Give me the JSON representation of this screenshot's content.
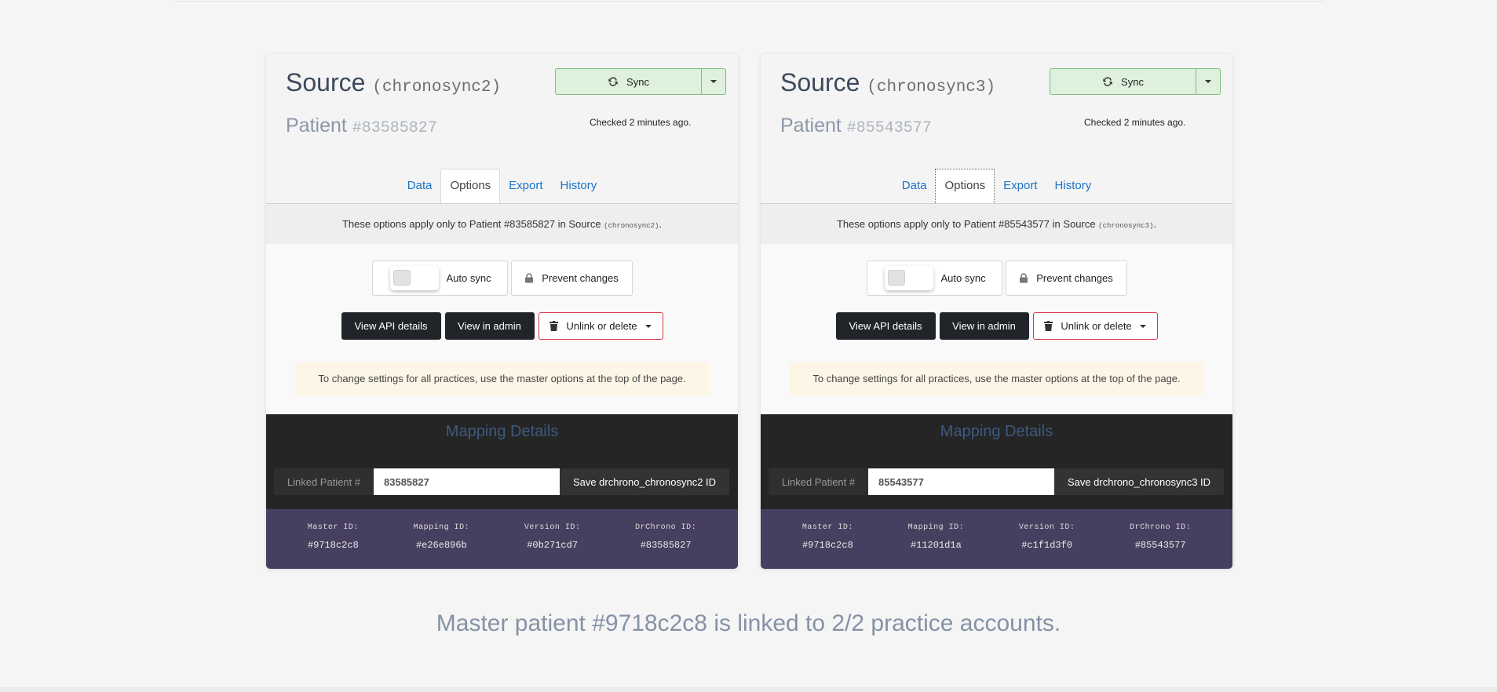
{
  "cards": [
    {
      "source_label": "Source",
      "source_code": "(chronosync2)",
      "patient_label": "Patient",
      "patient_num": "#83585827",
      "sync_label": "Sync",
      "checked": "Checked 2 minutes ago.",
      "tabs": [
        "Data",
        "Options",
        "Export",
        "History"
      ],
      "note_prefix": "These options apply only to Patient #83585827 in Source ",
      "note_code": "(chronosync2)",
      "note_suffix": ".",
      "auto_sync": "Auto sync",
      "prevent": "Prevent changes",
      "view_api": "View API details",
      "view_admin": "View in admin",
      "unlink": "Unlink or delete",
      "warn": "To change settings for all practices, use the master options at the top of the page.",
      "mapping_title": "Mapping Details",
      "linked_label": "Linked Patient #",
      "linked_value": "83585827",
      "save_label": "Save drchrono_chronosync2 ID",
      "ids": [
        {
          "label": "Master ID:",
          "value": "#9718c2c8"
        },
        {
          "label": "Mapping ID:",
          "value": "#e26e896b"
        },
        {
          "label": "Version ID:",
          "value": "#0b271cd7"
        },
        {
          "label": "DrChrono ID:",
          "value": "#83585827"
        }
      ]
    },
    {
      "source_label": "Source",
      "source_code": "(chronosync3)",
      "patient_label": "Patient",
      "patient_num": "#85543577",
      "sync_label": "Sync",
      "checked": "Checked 2 minutes ago.",
      "tabs": [
        "Data",
        "Options",
        "Export",
        "History"
      ],
      "note_prefix": "These options apply only to Patient #85543577 in Source ",
      "note_code": "(chronosync3)",
      "note_suffix": ".",
      "auto_sync": "Auto sync",
      "prevent": "Prevent changes",
      "view_api": "View API details",
      "view_admin": "View in admin",
      "unlink": "Unlink or delete",
      "warn": "To change settings for all practices, use the master options at the top of the page.",
      "mapping_title": "Mapping Details",
      "linked_label": "Linked Patient #",
      "linked_value": "85543577",
      "save_label": "Save drchrono_chronosync3 ID",
      "ids": [
        {
          "label": "Master ID:",
          "value": "#9718c2c8"
        },
        {
          "label": "Mapping ID:",
          "value": "#11201d1a"
        },
        {
          "label": "Version ID:",
          "value": "#c1f1d3f0"
        },
        {
          "label": "DrChrono ID:",
          "value": "#85543577"
        }
      ]
    }
  ],
  "footer": "Master patient #9718c2c8 is linked to 2/2 practice accounts.",
  "colors": {
    "sync_bg": "#ddf1dd",
    "danger": "#dc3545",
    "mapping_bg": "#252525",
    "ids_bg": "#473f5f",
    "tab_link": "#1a73c6"
  }
}
